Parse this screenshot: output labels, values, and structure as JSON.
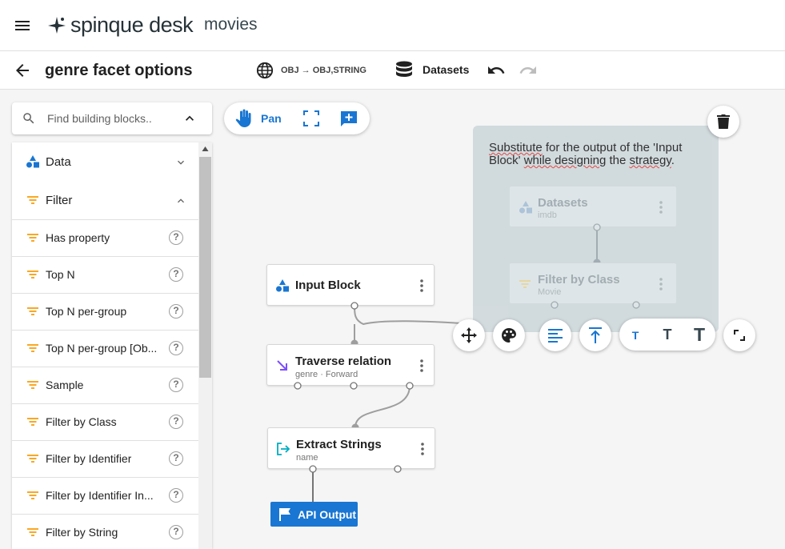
{
  "app": {
    "brand": "spinque desk",
    "project": "movies"
  },
  "header": {
    "title": "genre facet options",
    "type_signature": "OBJ → OBJ,STRING",
    "datasets_label": "Datasets"
  },
  "search": {
    "placeholder": "Find building blocks.."
  },
  "sidebar": {
    "categories": [
      {
        "label": "Data",
        "icon": "shapes-icon",
        "expanded": false
      },
      {
        "label": "Filter",
        "icon": "filter-icon",
        "expanded": true
      }
    ],
    "items": [
      {
        "label": "Has property"
      },
      {
        "label": "Top N"
      },
      {
        "label": "Top N per-group"
      },
      {
        "label": "Top N per-group [Ob..."
      },
      {
        "label": "Sample"
      },
      {
        "label": "Filter by Class"
      },
      {
        "label": "Filter by Identifier"
      },
      {
        "label": "Filter by Identifier In..."
      },
      {
        "label": "Filter by String"
      }
    ],
    "help_glyph": "?"
  },
  "canvas_toolbar": {
    "pan_label": "Pan"
  },
  "note": {
    "text_parts": [
      "Substitute",
      " for the output of the 'Input Block' ",
      "while designing",
      " the ",
      "strategy",
      "."
    ]
  },
  "ghost_nodes": [
    {
      "title": "Datasets",
      "subtitle": "imdb"
    },
    {
      "title": "Filter by Class",
      "subtitle": "Movie"
    }
  ],
  "nodes": [
    {
      "title": "Input Block",
      "subtitle": ""
    },
    {
      "title": "Traverse relation",
      "subtitle": "genre · Forward"
    },
    {
      "title": "Extract Strings",
      "subtitle": "name"
    }
  ],
  "text_sizes": [
    "T",
    "T",
    "T"
  ],
  "output": {
    "label": "API Output"
  },
  "colors": {
    "accent": "#1976d2",
    "filter_icon": "#f9a825",
    "traverse_icon": "#7c4dff",
    "extract_icon": "#00acc1",
    "note_bg": "#cfd8dc"
  }
}
